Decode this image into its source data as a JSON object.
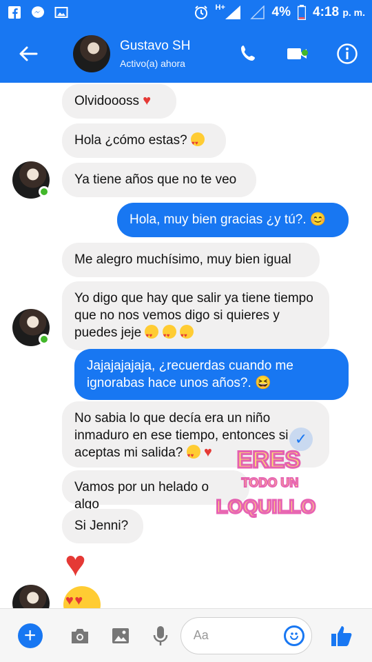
{
  "status_bar": {
    "network": "H+",
    "battery": "4%",
    "time": "4:18",
    "ampm": "p. m."
  },
  "header": {
    "name": "Gustavo SH",
    "status": "Activo(a) ahora"
  },
  "messages": [
    {
      "dir": "in",
      "text": "Olvidoooss",
      "emoji": "heart"
    },
    {
      "dir": "in",
      "text": "Hola ¿cómo estas?",
      "emoji": "face"
    },
    {
      "dir": "in",
      "text": "Ya tiene años que no te veo"
    },
    {
      "dir": "out",
      "text": "Hola, muy bien gracias ¿y tú?. 😊"
    },
    {
      "dir": "in",
      "text": "Me alegro muchísimo, muy bien igual"
    },
    {
      "dir": "in",
      "text": "Yo digo que hay que salir ya tiene tiempo que no nos vemos digo si quieres y puedes jeje",
      "emoji": "face3"
    },
    {
      "dir": "out",
      "text": "Jajajajajaja, ¿recuerdas cuando me ignorabas hace unos años?. 😆"
    },
    {
      "dir": "in",
      "text": "No sabia lo que decía era un niño inmaduro en ese tiempo, entonces si aceptas mi salida?",
      "emoji": "face_heart"
    },
    {
      "dir": "in",
      "text": "Vamos por un helado o algo"
    },
    {
      "dir": "in",
      "text": "Si Jenni?"
    }
  ],
  "watermark": {
    "line1": "ERES",
    "line2": "TODO UN",
    "line3": "LOQUILLO"
  },
  "composer": {
    "placeholder": "Aa"
  },
  "colors": {
    "accent": "#1877f2",
    "bubble_in": "#f1f0f0",
    "online": "#42b72a"
  }
}
